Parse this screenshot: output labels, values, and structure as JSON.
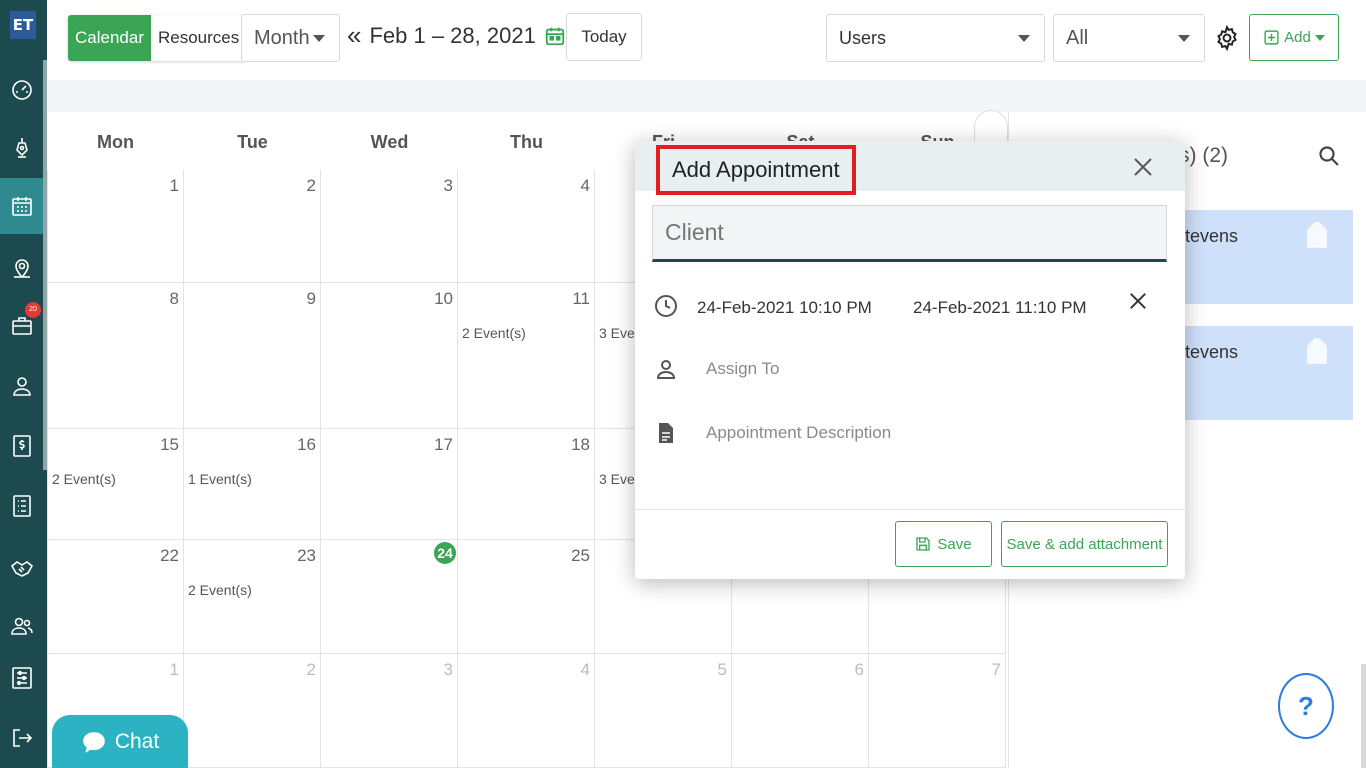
{
  "sidebar": {
    "logo": "ET",
    "items": [
      {
        "icon": "dashboard-gauge-icon"
      },
      {
        "icon": "pen-nib-icon"
      },
      {
        "icon": "calendar-icon",
        "active": true
      },
      {
        "icon": "map-pin-icon"
      },
      {
        "icon": "briefcase-icon",
        "badge": "20"
      },
      {
        "icon": "user-icon"
      },
      {
        "icon": "dollar-document-icon"
      },
      {
        "icon": "list-icon"
      },
      {
        "icon": "handshake-icon"
      },
      {
        "icon": "users-icon"
      },
      {
        "icon": "settings-sliders-icon"
      },
      {
        "icon": "logout-icon"
      }
    ]
  },
  "toolbar": {
    "calendar_label": "Calendar",
    "resources_label": "Resources",
    "view_value": "Month",
    "range_label": "Feb 1 – 28, 2021",
    "prev_glyph": "«",
    "next_glyph": "»",
    "today_label": "Today",
    "users_value": "Users",
    "filter_value": "All",
    "add_label": "Add",
    "accent": "#3aa655"
  },
  "calendar": {
    "days": [
      "Mon",
      "Tue",
      "Wed",
      "Thu",
      "Fri",
      "Sat",
      "Sun"
    ],
    "weeks": [
      [
        {
          "n": "1"
        },
        {
          "n": "2"
        },
        {
          "n": "3"
        },
        {
          "n": "4"
        },
        {
          "n": ""
        },
        {
          "n": ""
        },
        {
          "n": ""
        }
      ],
      [
        {
          "n": "8"
        },
        {
          "n": "9"
        },
        {
          "n": "10"
        },
        {
          "n": "11",
          "ev": "2 Event(s)"
        },
        {
          "n": "",
          "ev": "3 Even"
        },
        {
          "n": ""
        },
        {
          "n": ""
        }
      ],
      [
        {
          "n": "15",
          "ev": "2 Event(s)"
        },
        {
          "n": "16",
          "ev": "1 Event(s)"
        },
        {
          "n": "17"
        },
        {
          "n": "18"
        },
        {
          "n": "",
          "ev": "3 Even"
        },
        {
          "n": ""
        },
        {
          "n": ""
        }
      ],
      [
        {
          "n": "22"
        },
        {
          "n": "23",
          "ev": "2 Event(s)"
        },
        {
          "n": "24",
          "today": true
        },
        {
          "n": "25"
        },
        {
          "n": ""
        },
        {
          "n": ""
        },
        {
          "n": ""
        }
      ],
      [
        {
          "n": "1",
          "dim": true
        },
        {
          "n": "2",
          "dim": true
        },
        {
          "n": "3",
          "dim": true
        },
        {
          "n": "4",
          "dim": true
        },
        {
          "n": "5",
          "dim": true
        },
        {
          "n": "6",
          "dim": true
        },
        {
          "n": "7",
          "dim": true
        }
      ]
    ]
  },
  "right_panel": {
    "title": "s) (2)",
    "cards": [
      {
        "name": "tevens"
      },
      {
        "name": "tevens"
      }
    ],
    "help_label": "?"
  },
  "chat": {
    "label": "Chat"
  },
  "modal": {
    "title": "Add Appointment",
    "client_placeholder": "Client",
    "start": "24-Feb-2021 10:10 PM",
    "end": "24-Feb-2021 11:10 PM",
    "assign_placeholder": "Assign To",
    "description_placeholder": "Appointment Description",
    "save_label": "Save",
    "save_attach_label": "Save & add attachment"
  }
}
